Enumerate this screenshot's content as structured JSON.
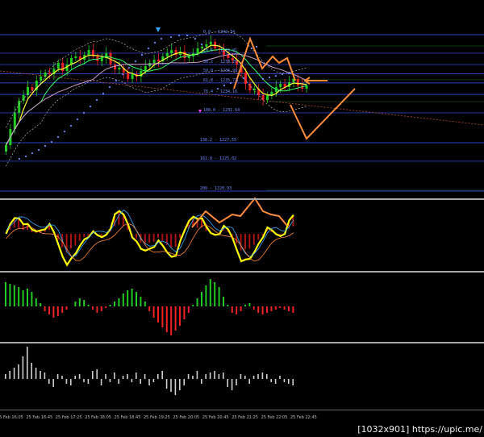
{
  "fib_levels": [
    {
      "label": "0.0 - 1242.34",
      "price": 1242.34
    },
    {
      "label": "23.6 - 1239.81",
      "price": 1239.81
    },
    {
      "label": "38.2 - 1238.25",
      "price": 1238.25
    },
    {
      "label": "50.0 - 1236.99",
      "price": 1236.99
    },
    {
      "label": "61.8 - 1235.73",
      "price": 1235.73
    },
    {
      "label": "76.4 - 1234.16",
      "price": 1234.16
    },
    {
      "label": "100.0 - 1231.64",
      "price": 1231.64
    },
    {
      "label": "138.2 - 1227.55",
      "price": 1227.55
    },
    {
      "label": "161.8 - 1225.02",
      "price": 1225.02
    },
    {
      "label": "200 - 1220.93",
      "price": 1220.93
    }
  ],
  "time_labels": [
    "25 Feb 16:05",
    "25 Feb 16:45",
    "25 Feb 17:25",
    "25 Feb 18:05",
    "25 Feb 18:45",
    "25 Feb 19:25",
    "25 Feb 20:05",
    "25 Feb 20:45",
    "25 Feb 21:25",
    "25 Feb 22:05",
    "25 Feb 22:45"
  ],
  "watermark": "[1032x901] https://upic.me/",
  "colors": {
    "bull": "#22cc22",
    "bear": "#ee2222",
    "fib": "#3a55ff",
    "stoch": "#ffff00",
    "annotation": "#ff8c3a",
    "separator": "#aaaaaa",
    "bands": "#d0d0d0",
    "sar": "#6b8cff"
  }
}
